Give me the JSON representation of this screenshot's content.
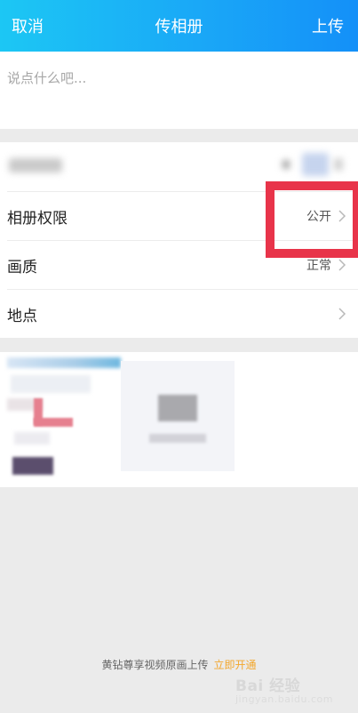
{
  "header": {
    "cancel_label": "取消",
    "title": "传相册",
    "upload_label": "上传",
    "background": "#1aa8f7"
  },
  "composer": {
    "placeholder": "说点什么吧...",
    "value": ""
  },
  "settings": {
    "rows": [
      {
        "label": "相册权限",
        "value": "公开",
        "icon": "chevron-right-icon"
      },
      {
        "label": "画质",
        "value": "正常",
        "icon": "chevron-right-icon"
      },
      {
        "label": "地点",
        "value": "",
        "icon": "chevron-right-icon"
      }
    ]
  },
  "annotation": {
    "color": "#e8344a"
  },
  "promo": {
    "text": "黄钻尊享视频原画上传",
    "link_label": "立即开通",
    "link_color": "#f3a72c"
  },
  "watermark": {
    "brand": "Bai 经验",
    "sub": "jingyan.baidu.com"
  }
}
